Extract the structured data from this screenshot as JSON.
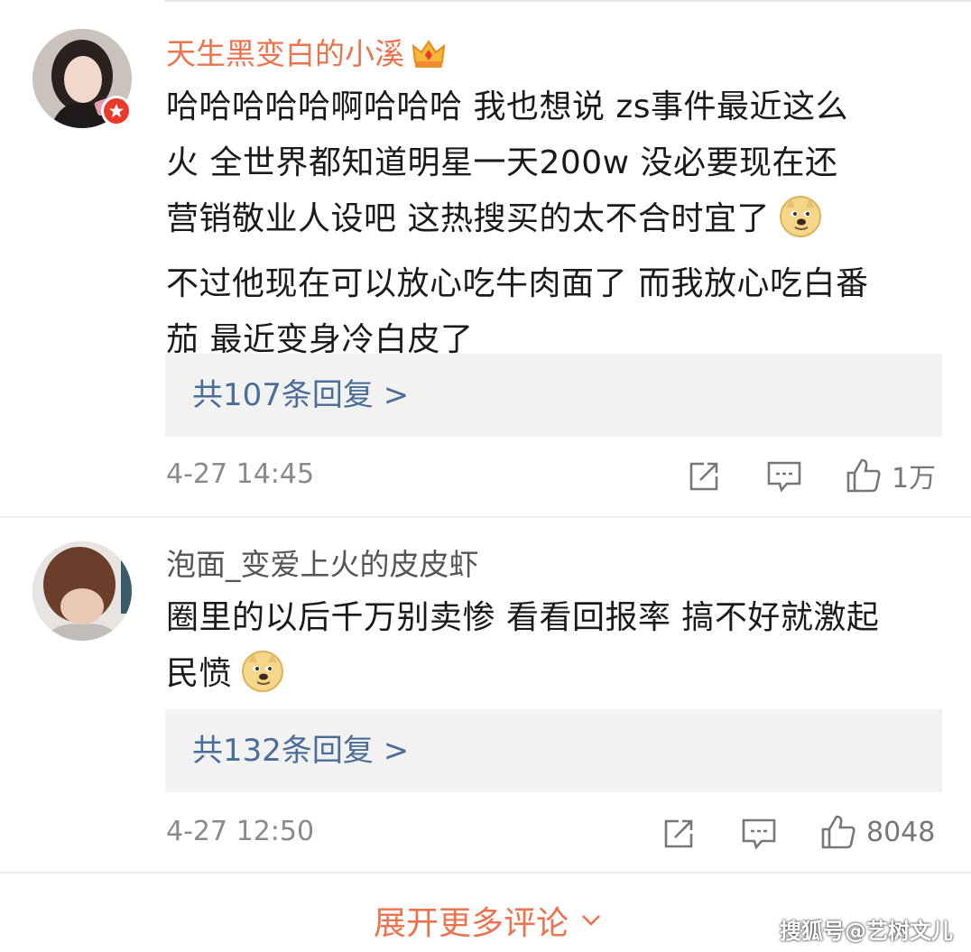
{
  "comments": [
    {
      "username": "天生黑变白的小溪",
      "is_vip": true,
      "text_lines": [
        "哈哈哈哈哈啊哈哈哈 我也想说 zs事件最近这么",
        "火  全世界都知道明星一天200w 没必要现在还",
        "营销敬业人设吧  这热搜买的太不合时宜了",
        "不过他现在可以放心吃牛肉面了 而我放心吃白番",
        "茄 最近变身冷白皮了"
      ],
      "reply_label": "共107条回复 >",
      "time": "4-27 14:45",
      "likes": "1万"
    },
    {
      "username": "泡面_变爱上火的皮皮虾",
      "is_vip": false,
      "text_lines": [
        "圈里的以后千万别卖惨 看看回报率 搞不好就激起",
        "民愤"
      ],
      "reply_label": "共132条回复 >",
      "time": "4-27 12:50",
      "likes": "8048"
    }
  ],
  "expand_label": "展开更多评论",
  "watermark": "搜狐号@艺树文儿",
  "colors": {
    "vip_name": "#eb7350",
    "reply_link": "#4b6d97",
    "expand": "#eb7350"
  }
}
